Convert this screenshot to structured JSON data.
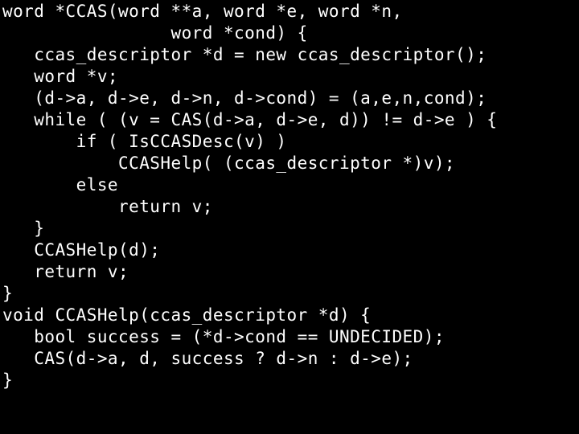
{
  "slide": {
    "background_color": "#000000",
    "text_color": "#ffffff",
    "language": "C++",
    "title": ""
  },
  "code": {
    "lines": [
      "word *CCAS(word **a, word *e, word *n,",
      "                word *cond) {",
      "   ccas_descriptor *d = new ccas_descriptor();",
      "   word *v;",
      "   (d->a, d->e, d->n, d->cond) = (a,e,n,cond);",
      "   while ( (v = CAS(d->a, d->e, d)) != d->e ) {",
      "       if ( IsCCASDesc(v) )",
      "           CCASHelp( (ccas_descriptor *)v);",
      "       else",
      "           return v;",
      "   }",
      "   CCASHelp(d);",
      "   return v;",
      "}",
      "void CCASHelp(ccas_descriptor *d) {",
      "   bool success = (*d->cond == UNDECIDED);",
      "   CAS(d->a, d, success ? d->n : d->e);",
      "}"
    ]
  }
}
